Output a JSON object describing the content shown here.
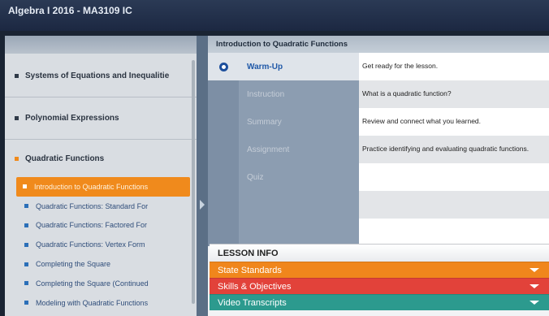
{
  "app": {
    "title": "Algebra I 2016 - MA3109 IC"
  },
  "sidebar": {
    "units": [
      {
        "label": "Systems of Equations and Inequalitie",
        "active": false
      },
      {
        "label": "Polynomial Expressions",
        "active": false
      },
      {
        "label": "Quadratic Functions",
        "active": true
      }
    ],
    "lessons": [
      {
        "label": "Introduction to Quadratic Functions",
        "current": true
      },
      {
        "label": "Quadratic Functions: Standard For",
        "current": false
      },
      {
        "label": "Quadratic Functions: Factored For",
        "current": false
      },
      {
        "label": "Quadratic Functions: Vertex Form",
        "current": false
      },
      {
        "label": "Completing the Square",
        "current": false
      },
      {
        "label": "Completing the Square (Continued",
        "current": false
      },
      {
        "label": "Modeling with Quadratic Functions",
        "current": false
      }
    ]
  },
  "main": {
    "header": "Introduction to Quadratic Functions",
    "activities": [
      {
        "name": "Warm-Up",
        "description": "Get ready for the lesson.",
        "current": true
      },
      {
        "name": "Instruction",
        "description": "What is a quadratic function?",
        "current": false
      },
      {
        "name": "Summary",
        "description": "Review and connect what you learned.",
        "current": false
      },
      {
        "name": "Assignment",
        "description": "Practice identifying and evaluating quadratic functions.",
        "current": false
      },
      {
        "name": "Quiz",
        "description": "",
        "current": false
      }
    ]
  },
  "lesson_info": {
    "title": "LESSON INFO",
    "sections": [
      {
        "label": "State Standards",
        "color": "#f0861c"
      },
      {
        "label": "Skills & Objectives",
        "color": "#e2423a"
      },
      {
        "label": "Video Transcripts",
        "color": "#2c9a8e"
      }
    ]
  }
}
